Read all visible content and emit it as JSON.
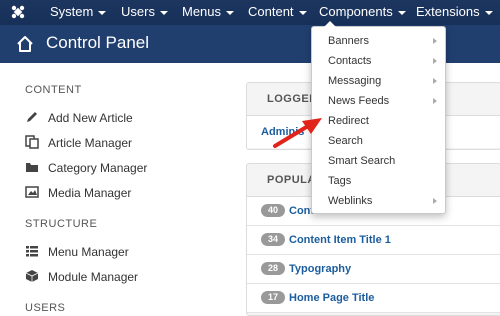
{
  "topbar": {
    "logo_icon": "joomla-logo-icon",
    "menus": [
      {
        "label": "System"
      },
      {
        "label": "Users"
      },
      {
        "label": "Menus"
      },
      {
        "label": "Content"
      },
      {
        "label": "Components"
      },
      {
        "label": "Extensions"
      }
    ]
  },
  "header": {
    "title": "Control Panel",
    "icon": "home-icon"
  },
  "sidebar": {
    "sections": [
      {
        "title": "CONTENT"
      },
      {
        "title": "STRUCTURE"
      },
      {
        "title": "USERS"
      }
    ],
    "links": [
      {
        "label": "Add New Article",
        "icon": "pencil-icon"
      },
      {
        "label": "Article Manager",
        "icon": "copy-icon"
      },
      {
        "label": "Category Manager",
        "icon": "folder-icon"
      },
      {
        "label": "Media Manager",
        "icon": "image-icon"
      },
      {
        "label": "Menu Manager",
        "icon": "list-icon"
      },
      {
        "label": "Module Manager",
        "icon": "cube-icon"
      }
    ]
  },
  "logged_panel": {
    "heading": "LOGGED",
    "row": "Adminis"
  },
  "popular_panel": {
    "heading": "POPULA",
    "rows": [
      {
        "count": "40",
        "title": "Cont"
      },
      {
        "count": "34",
        "title": "Content Item Title 1"
      },
      {
        "count": "28",
        "title": "Typography"
      },
      {
        "count": "17",
        "title": "Home Page Title"
      }
    ]
  },
  "components_menu": {
    "items": [
      {
        "label": "Banners",
        "submenu": true
      },
      {
        "label": "Contacts",
        "submenu": true
      },
      {
        "label": "Messaging",
        "submenu": true
      },
      {
        "label": "News Feeds",
        "submenu": true
      },
      {
        "label": "Redirect",
        "submenu": false
      },
      {
        "label": "Search",
        "submenu": false
      },
      {
        "label": "Smart Search",
        "submenu": false
      },
      {
        "label": "Tags",
        "submenu": false
      },
      {
        "label": "Weblinks",
        "submenu": true
      }
    ]
  },
  "colors": {
    "navbar": "#1d365f",
    "header": "#203f6f",
    "link": "#1c5d9e",
    "annotation_arrow": "#e2231a"
  }
}
